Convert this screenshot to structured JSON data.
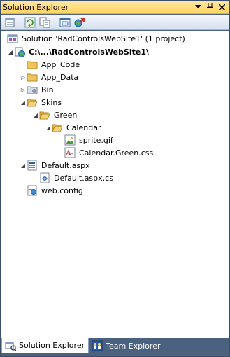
{
  "window": {
    "title": "Solution Explorer",
    "controls": [
      "pin-icon",
      "close-icon",
      "dropdown-icon"
    ]
  },
  "toolbar": {
    "buttons": [
      "properties-icon",
      "refresh-icon",
      "nest-related-files-icon",
      "view-designer-icon",
      "copy-website-icon"
    ]
  },
  "tree": {
    "solution": "Solution 'RadControlsWebSite1' (1 project)",
    "project": "C:\\...\\RadControlsWebSite1\\",
    "app_code": "App_Code",
    "app_data": "App_Data",
    "bin": "Bin",
    "skins": "Skins",
    "green": "Green",
    "calendar": "Calendar",
    "sprite": "sprite.gif",
    "calendar_css": "Calendar.Green.css",
    "default_aspx": "Default.aspx",
    "default_cs": "Default.aspx.cs",
    "web_config": "web.config"
  },
  "tabs": {
    "solution_explorer": "Solution Explorer",
    "team_explorer": "Team Explorer"
  },
  "colors": {
    "title_bar": "#ffd35e",
    "frame": "#4a6180",
    "folder": "#f2c55c"
  }
}
